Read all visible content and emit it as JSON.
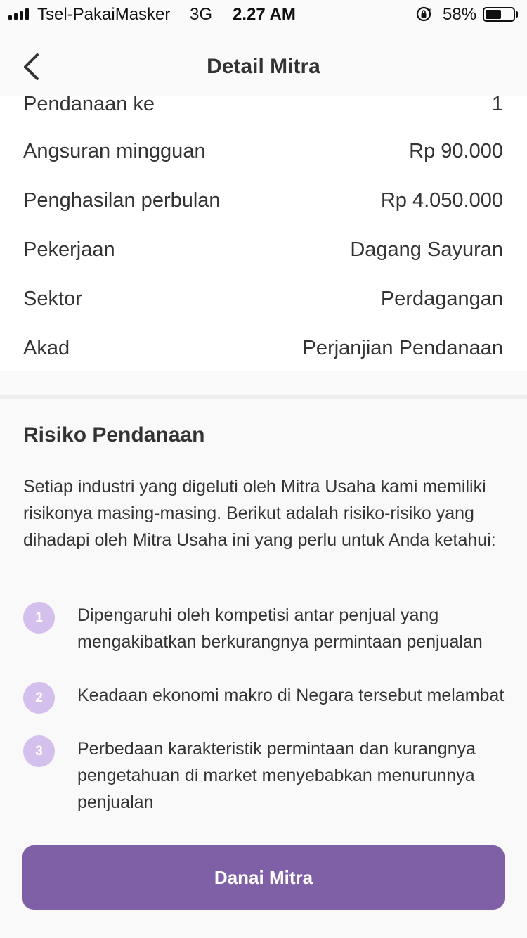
{
  "status_bar": {
    "carrier": "Tsel-PakaiMasker",
    "network": "3G",
    "time": "2.27 AM",
    "battery_percent": "58%",
    "battery_level": 0.58,
    "icons": [
      "signal-icon",
      "rotation-lock-icon",
      "battery-icon"
    ]
  },
  "header": {
    "title": "Detail Mitra",
    "back_icon": "chevron-left-icon"
  },
  "details": [
    {
      "label": "Pendanaan ke",
      "value": "1"
    },
    {
      "label": "Angsuran mingguan",
      "value": "Rp 90.000"
    },
    {
      "label": "Penghasilan perbulan",
      "value": "Rp 4.050.000"
    },
    {
      "label": "Pekerjaan",
      "value": "Dagang Sayuran"
    },
    {
      "label": "Sektor",
      "value": "Perdagangan"
    },
    {
      "label": "Akad",
      "value": "Perjanjian Pendanaan"
    }
  ],
  "risk": {
    "title": "Risiko Pendanaan",
    "description": "Setiap industri yang digeluti oleh Mitra Usaha kami memiliki risikonya masing-masing. Berikut adalah risiko-risiko yang dihadapi oleh Mitra Usaha ini yang perlu untuk Anda ketahui:",
    "items": [
      {
        "number": "1",
        "text": "Dipengaruhi oleh kompetisi antar penjual yang mengakibatkan berkurangnya permintaan penjualan"
      },
      {
        "number": "2",
        "text": "Keadaan ekonomi makro di Negara tersebut melambat"
      },
      {
        "number": "3",
        "text": "Perbedaan karakteristik permintaan dan kurangnya pengetahuan di market menyebabkan menurunnya penjualan"
      }
    ]
  },
  "cta": {
    "label": "Danai Mitra"
  },
  "colors": {
    "accent": "#7f5fa5",
    "badge": "#d4c0ec",
    "text": "#333333"
  }
}
